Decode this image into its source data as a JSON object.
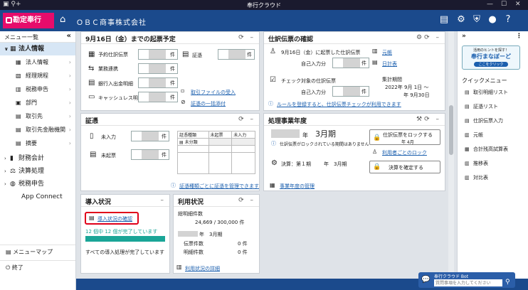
{
  "window": {
    "title": "奉行クラウド"
  },
  "app": {
    "brand": "勘定奉行",
    "company": "ＯＢＣ商事株式会社"
  },
  "left": {
    "header": "メニュー一覧",
    "collapse": "«",
    "selected": "法人情報",
    "subs": [
      "法人情報",
      "経理規程",
      "税務申告",
      "部門",
      "取引先",
      "取引先金融機関",
      "摘要"
    ],
    "cats": [
      "財務会計",
      "決算処理",
      "税務申告",
      "App Connect"
    ],
    "foot1": "メニューマップ",
    "foot2": "終了"
  },
  "p1": {
    "title": "9月16日（金）までの起票予定",
    "rows": [
      {
        "label": "予約仕訳伝票",
        "unit": "件"
      },
      {
        "label": "業務連携",
        "unit": "件"
      },
      {
        "label": "銀行入出金明細",
        "unit": "件"
      },
      {
        "label": "キャッシュレス明細",
        "unit": "件"
      }
    ],
    "voucher": "証憑",
    "vunit": "件",
    "link1": "取引ファイルの受入",
    "link2": "証憑の一括添付"
  },
  "p2": {
    "title": "仕訳伝票の確認",
    "a_label": "9月16日（金）に起票した仕訳伝票",
    "a_sub": "自己入力分",
    "unit": "件",
    "link_ledger": "元帳",
    "link_journal": "日計表",
    "b_label": "チェック対象の仕訳伝票",
    "b_sub": "自己入力分",
    "period_label": "集計期間",
    "period_from": "2022年 9月 1日 ～",
    "period_to": "年 9月30日",
    "rule_link": "ルールを登録すると、仕訳伝票チェックが利用できます"
  },
  "p3": {
    "title": "証憑",
    "r1": "未入力",
    "r2": "未起票",
    "unit": "件",
    "th": [
      "証憑種類",
      "未起票",
      "未入力"
    ],
    "row1": "未分類",
    "link": "証憑種類ごとに証憑を管理できます"
  },
  "p4": {
    "title": "処理事業年度",
    "nen": "年",
    "month": "3月期",
    "note": "仕訳伝票がロックされている期間はありません",
    "lock_btn": "仕訳伝票をロックする",
    "lock_sub": "年 4月",
    "lock_link": "利用者ごとのロック",
    "settle": "決算：第１期",
    "settle_month": "年　3月期",
    "settle_btn": "決算を確定する",
    "mgmt": "事業年度の管理"
  },
  "p5": {
    "title": "導入状況",
    "btn": "導入状況の確認",
    "progress": 1.0,
    "done_text": "12 個中 12 個が完了しています",
    "complete": "すべての導入処理が完了しています"
  },
  "p6": {
    "title": "利用状況",
    "total_label": "総明細件数",
    "total": "24,669 / 300,000 件",
    "year": "年　3月期",
    "slip_label": "伝票件数",
    "slip": "0 件",
    "detail_label": "明細件数",
    "detail": "0 件",
    "link": "利用状況の詳細"
  },
  "right": {
    "banner_top": "活用のヒントを探す！",
    "banner_main": "奉行まなぼーど",
    "banner_btn": "ここをクリック",
    "qtitle": "クイックメニュー",
    "items": [
      "取引明細リスト",
      "証憑リスト",
      "仕訳伝票入力",
      "元帳",
      "合計残高試算表",
      "推移表",
      "対比表"
    ]
  },
  "bot": {
    "title": "奉行クラウド Bot",
    "placeholder": "質問事項を入力してください"
  },
  "colors": {
    "brand": "#e60c6b",
    "header": "#1b4a8c",
    "link": "#1b5fae",
    "progress": "#1aa597",
    "highlight": "#e0001a"
  }
}
